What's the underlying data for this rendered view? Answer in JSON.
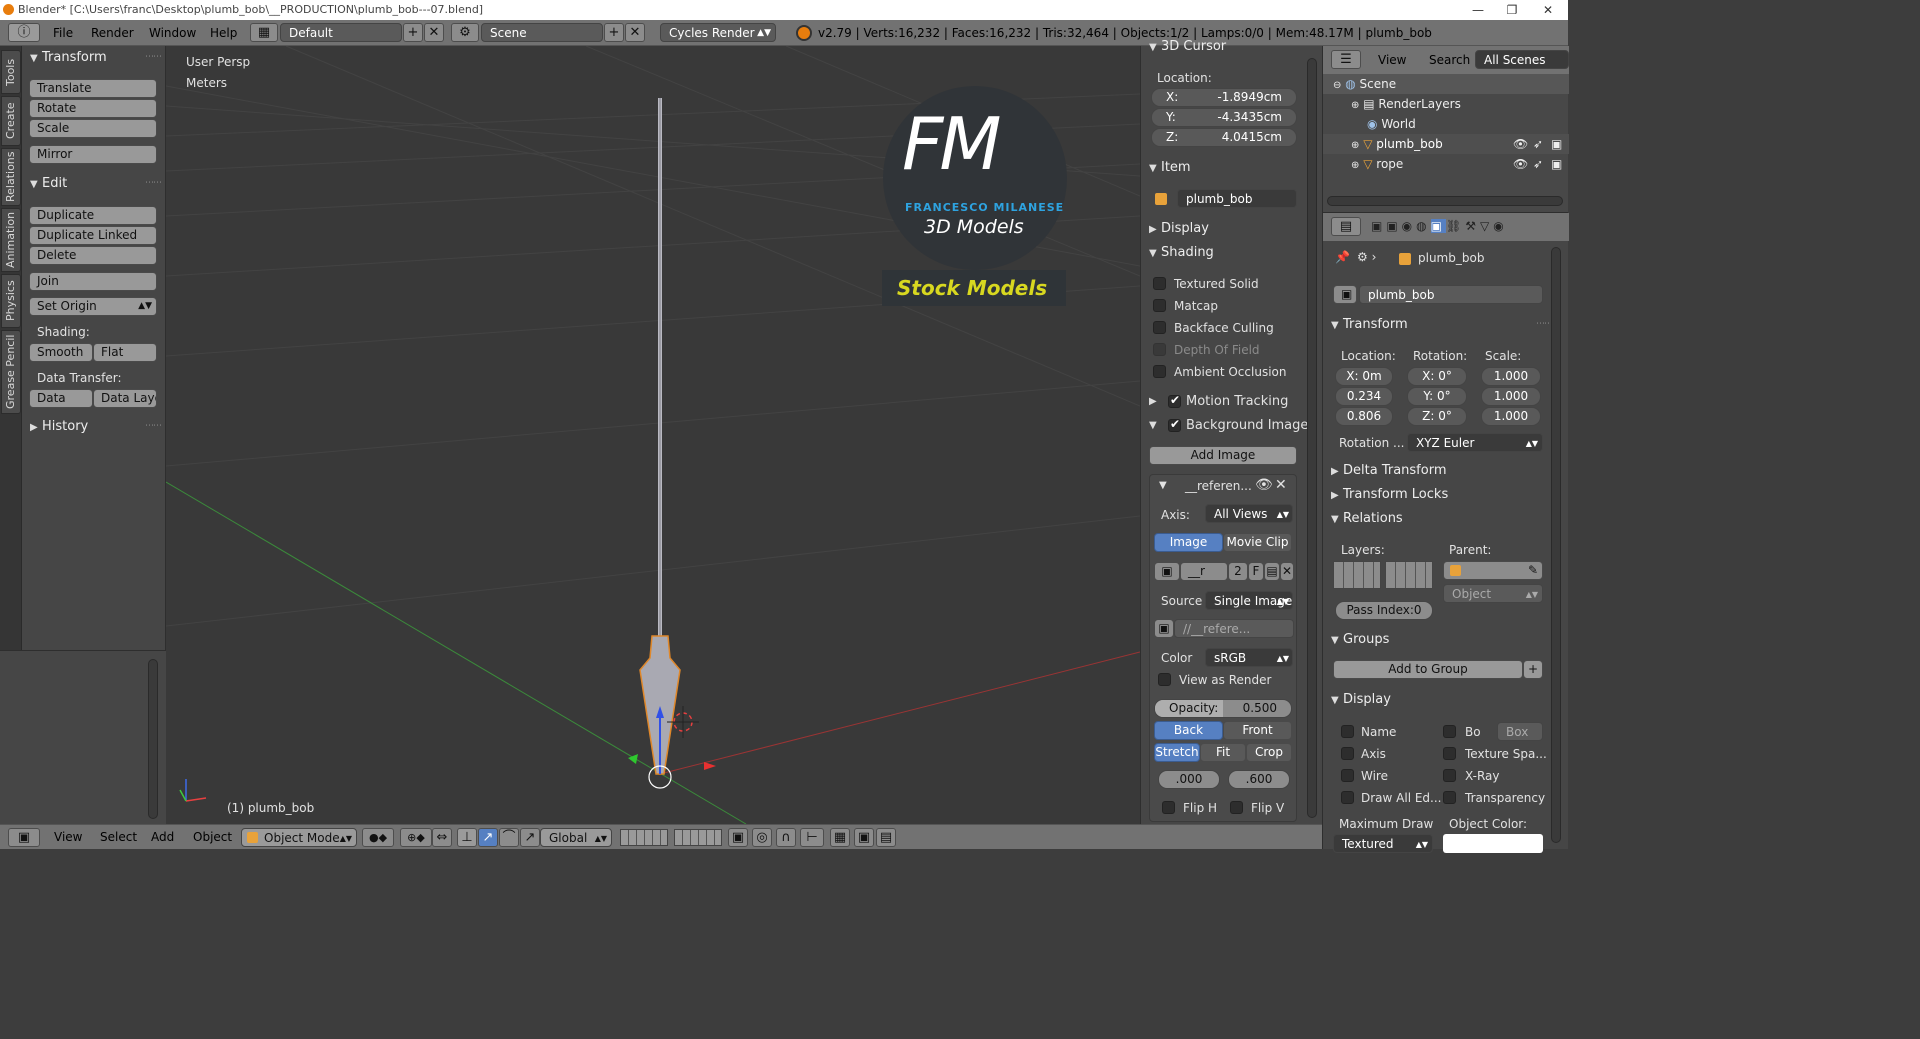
{
  "window": {
    "title": "Blender* [C:\\Users\\franc\\Desktop\\plumb_bob\\__PRODUCTION\\plumb_bob---07.blend]",
    "minimize": "—",
    "maximize": "❐",
    "close": "✕"
  },
  "topbar": {
    "menus": [
      "File",
      "Render",
      "Window",
      "Help"
    ],
    "layout": "Default",
    "scene": "Scene",
    "engine": "Cycles Render",
    "stats": "v2.79 | Verts:16,232 | Faces:16,232 | Tris:32,464 | Objects:1/2 | Lamps:0/0 | Mem:48.17M | plumb_bob"
  },
  "vtabs": [
    "Tools",
    "Create",
    "Relations",
    "Animation",
    "Physics",
    "Grease Pencil"
  ],
  "toolshelf": {
    "transform_header": "Transform",
    "translate": "Translate",
    "rotate": "Rotate",
    "scale": "Scale",
    "mirror": "Mirror",
    "edit_header": "Edit",
    "duplicate": "Duplicate",
    "duplicate_linked": "Duplicate Linked",
    "delete": "Delete",
    "join": "Join",
    "set_origin": "Set Origin",
    "shading_label": "Shading:",
    "smooth": "Smooth",
    "flat": "Flat",
    "data_transfer_label": "Data Transfer:",
    "data": "Data",
    "data_layout": "Data Layo",
    "history": "History"
  },
  "viewport": {
    "view_name": "User Persp",
    "units": "Meters",
    "object_label": "(1) plumb_bob",
    "watermark": {
      "initials": "FM",
      "author": "FRANCESCO MILANESE",
      "tagline": "3D Models",
      "stock": "Stock Models"
    }
  },
  "npanel": {
    "cursor_header": "3D Cursor",
    "location_label": "Location:",
    "x": "X:",
    "y": "Y:",
    "z": "Z:",
    "x_val": "-1.8949cm",
    "y_val": "-4.3435cm",
    "z_val": "4.0415cm",
    "item_header": "Item",
    "item_name": "plumb_bob",
    "display_header": "Display",
    "shading_header": "Shading",
    "textured_solid": "Textured Solid",
    "matcap": "Matcap",
    "backface": "Backface Culling",
    "dof": "Depth Of Field",
    "ao": "Ambient Occlusion",
    "motion_tracking": "Motion Tracking",
    "bg_images": "Background Images",
    "add_image": "Add Image",
    "ref_name": "__referen...",
    "axis_label": "Axis:",
    "axis_value": "All Views",
    "image_tab": "Image",
    "movie_tab": "Movie Clip",
    "img_field": "__r",
    "img_users": "2",
    "img_f": "F",
    "source_label": "Source",
    "source_value": "Single Image",
    "filepath": "//__refere...",
    "color_label": "Color",
    "color_value": "sRGB",
    "view_as_render": "View as Render",
    "opacity_label": "Opacity:",
    "opacity_value": "0.500",
    "back": "Back",
    "front": "Front",
    "stretch": "Stretch",
    "fit": "Fit",
    "crop": "Crop",
    "offset_x": ".000",
    "offset_y": ".600",
    "flip_h": "Flip H",
    "flip_v": "Flip V"
  },
  "outliner": {
    "view": "View",
    "search": "Search",
    "filter": "All Scenes",
    "items": [
      "Scene",
      "RenderLayers",
      "World",
      "plumb_bob",
      "rope"
    ]
  },
  "props": {
    "breadcrumb": "plumb_bob",
    "object_name": "plumb_bob",
    "transform_header": "Transform",
    "location_label": "Location:",
    "rotation_label": "Rotation:",
    "scale_label": "Scale:",
    "loc": [
      "X: 0m",
      "0.234",
      "0.806"
    ],
    "rot": [
      "X:  0°",
      "Y:  0°",
      "Z:  0°"
    ],
    "scale": [
      "1.000",
      "1.000",
      "1.000"
    ],
    "rotation_mode_label": "Rotation ...",
    "rotation_mode": "XYZ Euler",
    "delta": "Delta Transform",
    "locks": "Transform Locks",
    "relations": "Relations",
    "layers_label": "Layers:",
    "parent_label": "Parent:",
    "parent_type": "Object",
    "pass_index": "Pass Index:0",
    "groups": "Groups",
    "add_to_group": "Add to Group",
    "display": "Display",
    "name": "Name",
    "bo": "Bo",
    "box": "Box",
    "axis": "Axis",
    "texture_space": "Texture Spa...",
    "wire": "Wire",
    "xray": "X-Ray",
    "draw_all": "Draw All Ed...",
    "transparency": "Transparency",
    "max_draw": "Maximum Draw",
    "obj_color": "Object Color:",
    "textured": "Textured"
  },
  "bottombar": {
    "view": "View",
    "select": "Select",
    "add": "Add",
    "object": "Object",
    "mode": "Object Mode",
    "orientation": "Global"
  }
}
